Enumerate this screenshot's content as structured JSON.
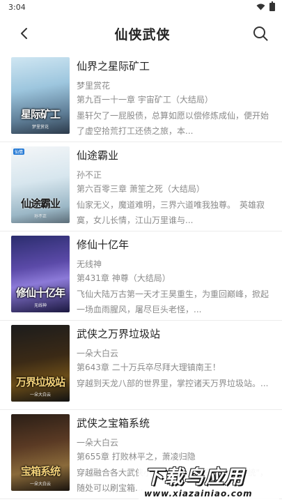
{
  "status": {
    "time": "3:04"
  },
  "header": {
    "title": "仙侠武侠",
    "back_icon": "back-arrow-icon",
    "search_icon": "search-icon"
  },
  "books": [
    {
      "title": "仙界之星际矿工",
      "author": "梦里赏花",
      "chapter": "第九百一十一章 宇宙矿工（大结局）",
      "description": "墨轩欠了一屁股债，总算如愿以偿修炼成仙，便开始了虚空拾荒打工还债之旅，本...",
      "cover_text": "星际矿工",
      "cover_author": "梦里赏花"
    },
    {
      "title": "仙途霸业",
      "author": "孙不正",
      "chapter": "第六百零三章 萧笙之死（大结局）",
      "description": "仙家无义，魔道难明，三界六道唯我独尊。　英雄寂寞，女儿长情，江山万里谁与...",
      "cover_text": "仙途霸业",
      "cover_author": "孙不正",
      "cover_badge": "仙情"
    },
    {
      "title": "修仙十亿年",
      "author": "无线神",
      "chapter": "第431章 神尊（大结局）",
      "description": "飞仙大陆万古第一天才王昊重生，为重回巅峰，掀起一场血雨腥风，屠尽巨头老怪，...",
      "cover_text": "修仙十亿年",
      "cover_author": "无线神"
    },
    {
      "title": "武侠之万界垃圾站",
      "author": "一朵大白云",
      "chapter": "第643章 二十万兵卒尽拜大理镇南王！",
      "description": "穿越到天龙八部的世界里，掌控诸天万界垃圾站。...",
      "cover_text": "万界垃圾站",
      "cover_author": "一朵大白云"
    },
    {
      "title": "武侠之宝箱系统",
      "author": "一朵大白云",
      "chapter": "第655章 打败林平之，萧凌归隐",
      "description": "穿越融合各大武侠小说的世界里，获得\"宝箱系统\"，随处可以刷宝箱...",
      "cover_text": "宝箱系统",
      "cover_author": "一朵大白云"
    }
  ],
  "watermark": {
    "main": "下载鸟应用",
    "url": "www.xiazainiao.com"
  }
}
